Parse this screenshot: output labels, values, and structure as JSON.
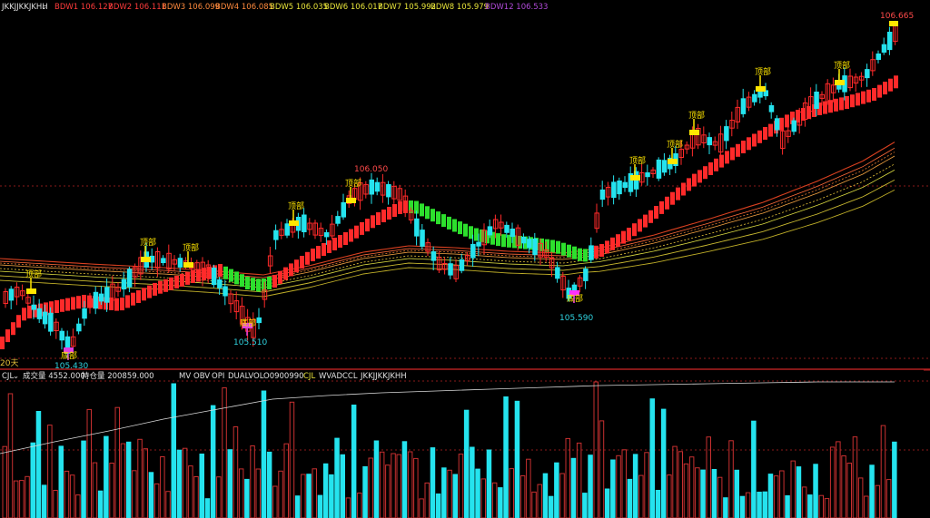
{
  "top_bar": {
    "indicator_name": "JKKJJKKJKHH",
    "items": [
      {
        "text": "BDW1 106.127",
        "color": "#ff3b3b"
      },
      {
        "text": "BDW2 106.111",
        "color": "#ff3b3b"
      },
      {
        "text": "BDW3 106.099",
        "color": "#ff8a3d"
      },
      {
        "text": "BDW4 106.085",
        "color": "#ff8a3d"
      },
      {
        "text": "BDW5 106.035",
        "color": "#e8e43a"
      },
      {
        "text": "BDW6 106.017",
        "color": "#e8e43a"
      },
      {
        "text": "BDW7 105.992",
        "color": "#e8e43a"
      },
      {
        "text": "BDW8 105.979",
        "color": "#e8e43a"
      },
      {
        "text": "BDW12 106.533",
        "color": "#b04ad8"
      }
    ]
  },
  "main_chart": {
    "price_labels": {
      "last_high": "106.665",
      "peak_mid": "106.050",
      "low_left": "105.430",
      "low_mid": "105.510",
      "low_right": "105.590"
    },
    "top_markers": [
      "顶部",
      "顶部",
      "顶部",
      "顶部",
      "顶部",
      "顶部",
      "顶部",
      "顶部",
      "顶部",
      "顶部"
    ],
    "bottom_markers": [
      "底部",
      "底部",
      "底部"
    ],
    "corner_label": "20天"
  },
  "volume_bar": {
    "indicator": "CJL",
    "volume_text": "成交量 4552.000",
    "oi_text": "持仓量 200859.000",
    "tabs": [
      "MV",
      "OBV",
      "OPI",
      "DUALVOL",
      "O0900990",
      "CJL",
      "WVAD",
      "CCL",
      "JKKJJKKJKHH"
    ]
  },
  "colors": {
    "background": "#000000",
    "up": "#ff2a2a",
    "down": "#25e3ee",
    "band_green": "#2de02d",
    "marker_yellow": "#ffe600",
    "marker_magenta": "#ff30ff",
    "cyan_text": "#2fd3e0"
  }
}
